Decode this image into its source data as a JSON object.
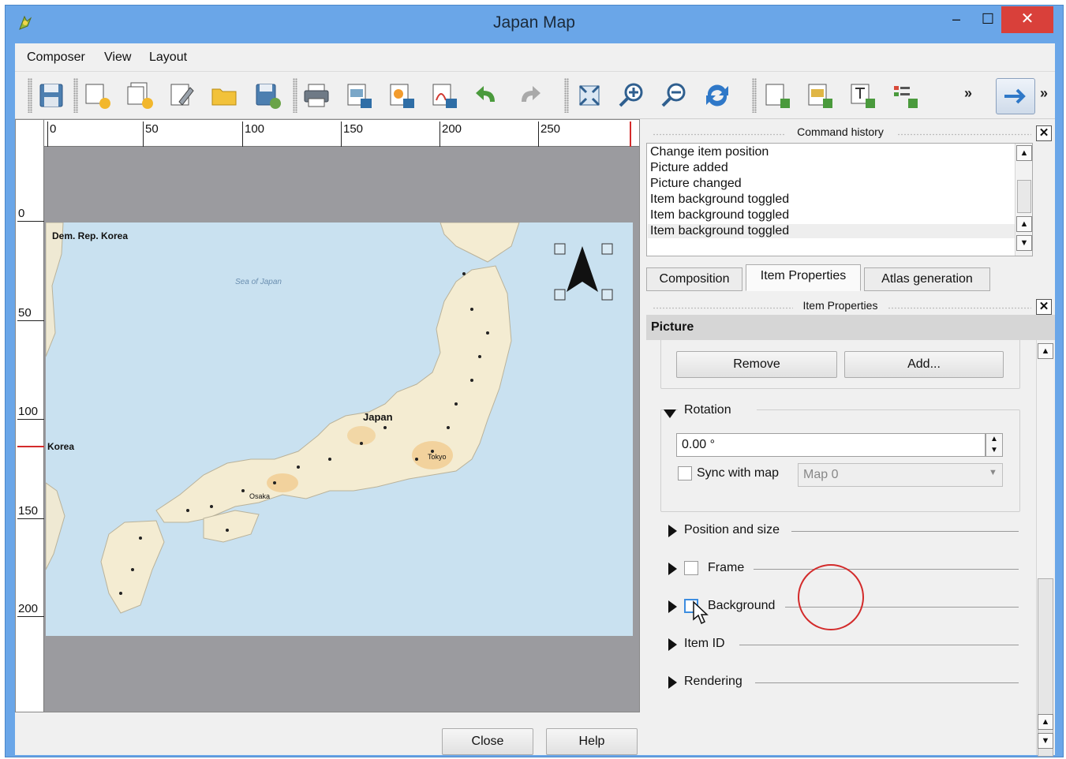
{
  "window": {
    "title": "Japan Map",
    "minimize_glyph": "–",
    "maximize_glyph": "☐",
    "close_glyph": "✕"
  },
  "menu": [
    "Composer",
    "View",
    "Layout"
  ],
  "toolbar": {
    "icons": [
      "save-icon",
      "new-composer-icon",
      "duplicate-composer-icon",
      "composer-manager-icon",
      "open-template-icon",
      "save-template-icon",
      "print-icon",
      "export-image-icon",
      "export-svg-icon",
      "export-pdf-icon",
      "undo-icon",
      "redo-icon",
      "zoom-full-icon",
      "zoom-in-icon",
      "zoom-out-icon",
      "refresh-icon",
      "add-map-icon",
      "add-image-icon",
      "add-label-icon",
      "add-legend-icon",
      "select-move-icon"
    ],
    "overflow_glyph": "»"
  },
  "ruler": {
    "top_labels": [
      "0",
      "50",
      "100",
      "150",
      "200",
      "250"
    ],
    "left_labels": [
      "0",
      "50",
      "100",
      "150",
      "200"
    ]
  },
  "map": {
    "labels": [
      "Dem. Rep. Korea",
      "Korea",
      "Japan",
      "Sea of Japan",
      "Tokyo",
      "Osaka"
    ]
  },
  "dialog_buttons": {
    "close": "Close",
    "help": "Help"
  },
  "command_history": {
    "title": "Command history",
    "items": [
      "Change item position",
      "Picture added",
      "Picture changed",
      "Item background toggled",
      "Item background toggled",
      "Item background toggled"
    ]
  },
  "tabs": [
    "Composition",
    "Item Properties",
    "Atlas generation"
  ],
  "item_properties": {
    "title": "Item Properties",
    "section": "Picture",
    "remove_label": "Remove",
    "add_label": "Add...",
    "rotation_label": "Rotation",
    "rotation_value": "0.00 °",
    "sync_label": "Sync with map",
    "map_combo": "Map 0",
    "groups": [
      "Position and size",
      "Frame",
      "Background",
      "Item ID",
      "Rendering"
    ]
  }
}
